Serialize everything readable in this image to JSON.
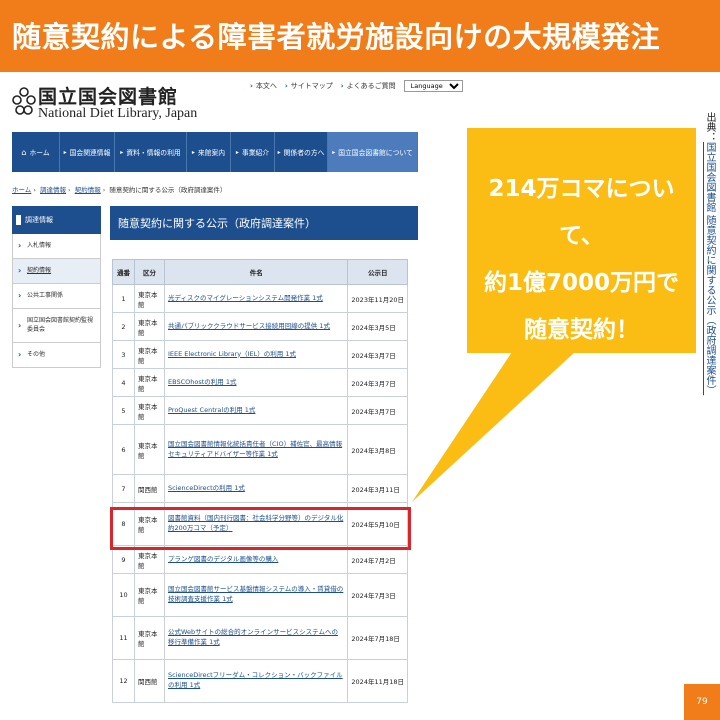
{
  "slide": {
    "title": "随意契約による障害者就労施設向けの大規模発注",
    "callout_lines": [
      "214万コマについて、",
      "約1億7000万円で",
      "随意契約！"
    ],
    "source_label": "出典：",
    "source_link": "国立国会図書館 随意契約に関する公示（政府調達案件）",
    "page_number": "79",
    "colors": {
      "title_bar": "#f07d1a",
      "callout": "#fbbd14",
      "highlight": "#d9262b",
      "nav": "#1d4f8f"
    }
  },
  "site": {
    "logo_jp": "国立国会図書館",
    "logo_en": "National Diet Library, Japan",
    "util_links": [
      "本文へ",
      "サイトマップ",
      "よくあるご質問"
    ],
    "language_select": "Language"
  },
  "nav": {
    "items": [
      "ホーム",
      "国会関連情報",
      "資料・情報の利用",
      "来館案内",
      "事業紹介",
      "関係者の方へ",
      "国立国会図書館について"
    ]
  },
  "breadcrumb": [
    "ホーム",
    "調達情報",
    "契約情報",
    "随意契約に関する公示（政府調達案件）"
  ],
  "sidebar": {
    "heading": "調達情報",
    "items": [
      "入札情報",
      "契約情報",
      "公共工事関係",
      "国立国会図書館契約監視委員会",
      "その他"
    ]
  },
  "main": {
    "heading": "随意契約に関する公示（政府調達案件）",
    "columns": [
      "通番",
      "区分",
      "件名",
      "公示日"
    ],
    "rows": [
      {
        "no": "1",
        "dept": "東京本館",
        "title": "光ディスクのマイグレーションシステム開発作業 1式",
        "date": "2023年11月20日"
      },
      {
        "no": "2",
        "dept": "東京本館",
        "title": "共通パブリッククラウドサービス接続用回線の提供 1式",
        "date": "2024年3月5日"
      },
      {
        "no": "3",
        "dept": "東京本館",
        "title": "IEEE Electronic Library（IEL）の利用 1式",
        "date": "2024年3月7日"
      },
      {
        "no": "4",
        "dept": "東京本館",
        "title": "EBSCOhostの利用 1式",
        "date": "2024年3月7日"
      },
      {
        "no": "5",
        "dept": "東京本館",
        "title": "ProQuest Centralの利用 1式",
        "date": "2024年3月7日"
      },
      {
        "no": "6",
        "dept": "東京本館",
        "title": "国立国会図書館情報化統括責任者（CIO）補佐官、最高情報セキュリティアドバイザー等作業 1式",
        "date": "2024年3月8日"
      },
      {
        "no": "7",
        "dept": "関西館",
        "title": "ScienceDirectの利用 1式",
        "date": "2024年3月11日"
      },
      {
        "no": "8",
        "dept": "東京本館",
        "title": "図書館資料（国内刊行図書：社会科学分野等）のデジタル化 約200万コマ（予定）",
        "date": "2024年5月10日"
      },
      {
        "no": "9",
        "dept": "東京本館",
        "title": "プランゲ図書のデジタル画像等の購入",
        "date": "2024年7月2日"
      },
      {
        "no": "10",
        "dept": "東京本館",
        "title": "国立国会図書館サービス基盤情報システムの導入・賃貸借の技術調査支援作業 1式",
        "date": "2024年7月3日"
      },
      {
        "no": "11",
        "dept": "東京本館",
        "title": "公式Webサイトの総合的オンラインサービスシステムへの移行準備作業 1式",
        "date": "2024年7月18日"
      },
      {
        "no": "12",
        "dept": "関西館",
        "title": "ScienceDirectフリーダム・コレクション・バックファイルの利用 1式",
        "date": "2024年11月18日"
      }
    ]
  }
}
